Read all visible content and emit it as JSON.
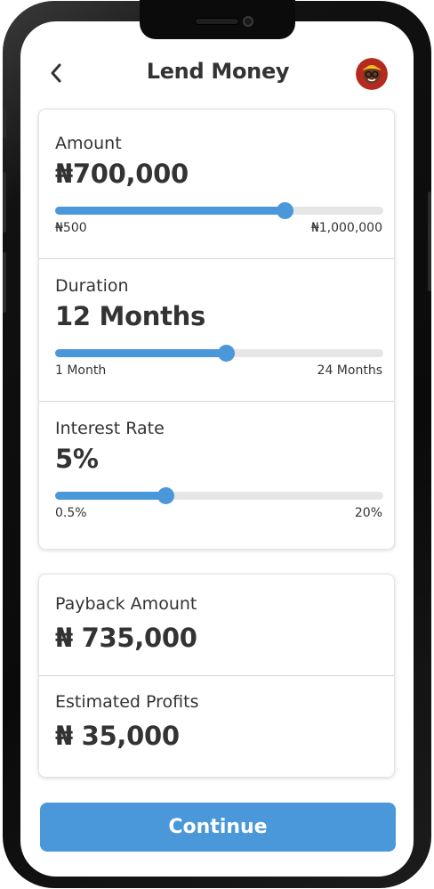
{
  "header": {
    "title": "Lend Money",
    "back_icon": "chevron-left-icon",
    "avatar_icon": "user-avatar-icon"
  },
  "amount": {
    "label": "Amount",
    "value": "₦700,000",
    "min_label": "₦500",
    "max_label": "₦1,000,000",
    "fraction": 0.7
  },
  "duration": {
    "label": "Duration",
    "value": "12 Months",
    "min_label": "1 Month",
    "max_label": "24 Months",
    "fraction": 0.52
  },
  "interest": {
    "label": "Interest Rate",
    "value": "5%",
    "min_label": "0.5%",
    "max_label": "20%",
    "fraction": 0.335
  },
  "payback": {
    "label": "Payback Amount",
    "value": "₦ 735,000"
  },
  "profits": {
    "label": "Estimated Profits",
    "value": "₦ 35,000"
  },
  "continue_label": "Continue",
  "colors": {
    "accent": "#4a98da",
    "text": "#333333",
    "track": "#e6e6e6"
  }
}
